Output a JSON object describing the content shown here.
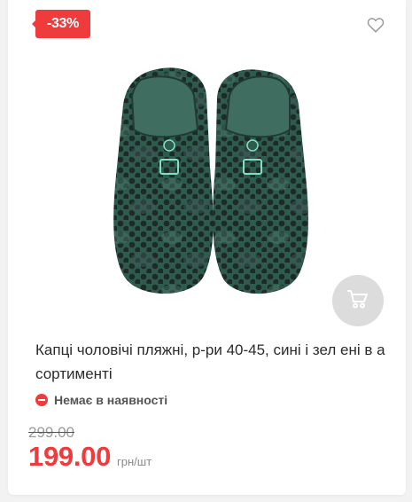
{
  "badge": {
    "discount": "-33%"
  },
  "product": {
    "title": "Капці чоловічі пляжні, р-ри 40-45, сині і зел ені в асортименті",
    "image_icon": "clogs-image"
  },
  "stock": {
    "status": "Немає в наявності"
  },
  "pricing": {
    "old_price": "299.00",
    "price": "199.00",
    "unit": "грн/шт"
  },
  "icons": {
    "wishlist": "heart-icon",
    "cart": "cart-icon",
    "stock": "minus-circle-icon"
  },
  "colors": {
    "accent": "#ef3b3b",
    "cart_bg": "#dcdcdc",
    "product": "#2f5a4e"
  }
}
